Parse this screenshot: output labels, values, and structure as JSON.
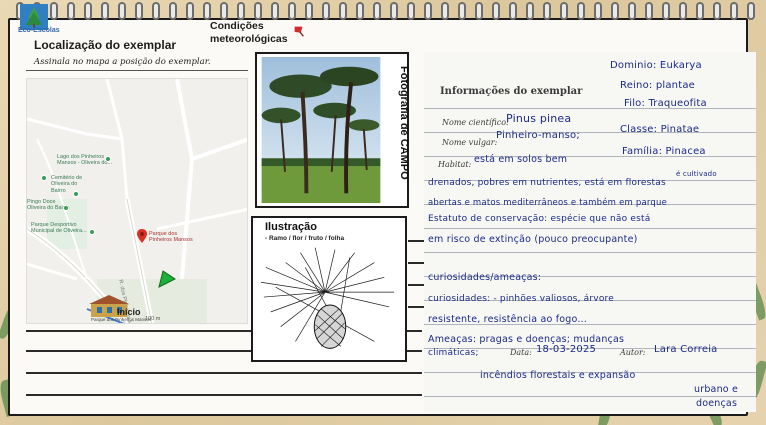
{
  "logo": {
    "text": "Eco-Escolas"
  },
  "weather": {
    "label_line1": "Condições",
    "label_line2": "meteorológicas"
  },
  "location": {
    "title": "Localização do exemplar",
    "instruction": "Assinala no mapa a posição do exemplar."
  },
  "map": {
    "labels": {
      "lago": "Lago dos Pinheiros Mansos - Oliveira do...",
      "cemiterio": "Cemitério de Oliveira do Bairro",
      "pingo": "Pingo Doce Oliveira do Bairro",
      "parque_desportivo": "Parque Desportivo Municipal de Oliveira...",
      "parque": "Parque dos Pinheiros Mansos",
      "rua": "R. dos Pinheiros Mansos",
      "inicio": "Inicio",
      "inicio_sub": "Parque dos Pinheiros Mansos",
      "scale": "100 m"
    }
  },
  "photo": {
    "title": "Fotografia de CAMPO"
  },
  "illustration": {
    "title": "Ilustração",
    "subtitle": "- Ramo / flor / fruto  / folha"
  },
  "notes": {
    "title": "Informações do exemplar",
    "nome_cientifico_label": "Nome científico:",
    "nome_cientifico": "Pinus pinea",
    "nome_vulgar_label": "Nome vulgar:",
    "nome_vulgar": "Pinheiro-manso;",
    "dominio": "Dominio: Eukarya",
    "reino": "Reino: plantae",
    "filo": "Filo: Traqueofita",
    "classe": "Classe: Pinatae",
    "habitat_label": "Habitat:",
    "habitat1": "está em solos bem",
    "familia": "Família: Pinacea",
    "habitat2": "drenados, pobres em nutrientes, está em florestas",
    "habitat3": "abertas e matos mediterrâneos e também em parque",
    "cultivado": "é cultivado",
    "estatuto": "Estatuto de conservação: espécie que não está",
    "estatuto2": "em risco de extinção (pouco preocupante)",
    "curiosidades_ameacas": "curiosidades/ameaças:",
    "curiosidades": "curiosidades: - pinhões valiosos, árvore",
    "curiosidades2": "resistente, resistência ao fogo...",
    "ameacas": "Ameaças: pragas e doenças; mudanças",
    "climaticas": "climáticas;",
    "data_label": "Data:",
    "data": "18-03-2025",
    "autor_label": "Autor:",
    "autor": "Lara Correia",
    "incendios": "incêndios florestais e expansão",
    "urbano": "urbano e",
    "doencas": "doenças"
  }
}
